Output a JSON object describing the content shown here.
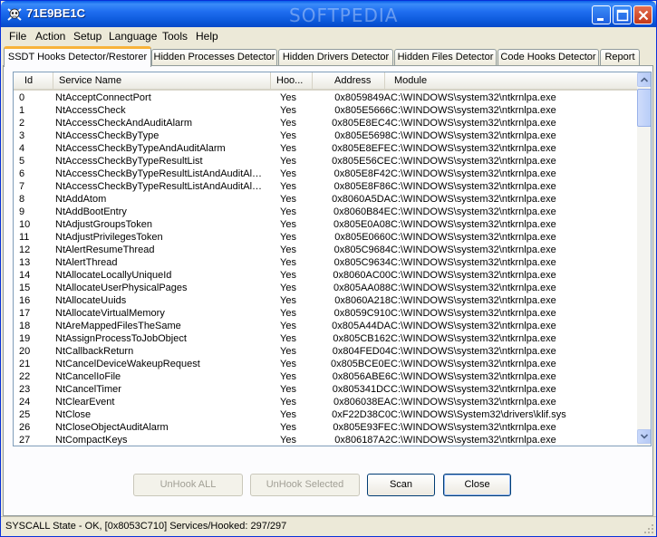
{
  "window": {
    "title": "71E9BE1C",
    "watermark": "SOFTPEDIA"
  },
  "menu": [
    "File",
    "Action",
    "Setup",
    "Language",
    "Tools",
    "Help"
  ],
  "tabs": [
    {
      "label": "SSDT Hooks Detector/Restorer",
      "active": true
    },
    {
      "label": "Hidden Processes Detector",
      "active": false
    },
    {
      "label": "Hidden Drivers Detector",
      "active": false
    },
    {
      "label": "Hidden Files Detector",
      "active": false
    },
    {
      "label": "Code Hooks Detector",
      "active": false
    },
    {
      "label": "Report",
      "active": false
    }
  ],
  "table": {
    "columns": [
      "Id",
      "Service Name",
      "Hoo...",
      "Address",
      "Module"
    ],
    "rows": [
      [
        "0",
        "NtAcceptConnectPort",
        "Yes",
        "0x8059849A",
        "C:\\WINDOWS\\system32\\ntkrnlpa.exe"
      ],
      [
        "1",
        "NtAccessCheck",
        "Yes",
        "0x805E5666",
        "C:\\WINDOWS\\system32\\ntkrnlpa.exe"
      ],
      [
        "2",
        "NtAccessCheckAndAuditAlarm",
        "Yes",
        "0x805E8EC4",
        "C:\\WINDOWS\\system32\\ntkrnlpa.exe"
      ],
      [
        "3",
        "NtAccessCheckByType",
        "Yes",
        "0x805E5698",
        "C:\\WINDOWS\\system32\\ntkrnlpa.exe"
      ],
      [
        "4",
        "NtAccessCheckByTypeAndAuditAlarm",
        "Yes",
        "0x805E8EFE",
        "C:\\WINDOWS\\system32\\ntkrnlpa.exe"
      ],
      [
        "5",
        "NtAccessCheckByTypeResultList",
        "Yes",
        "0x805E56CE",
        "C:\\WINDOWS\\system32\\ntkrnlpa.exe"
      ],
      [
        "6",
        "NtAccessCheckByTypeResultListAndAuditAlarm",
        "Yes",
        "0x805E8F42",
        "C:\\WINDOWS\\system32\\ntkrnlpa.exe"
      ],
      [
        "7",
        "NtAccessCheckByTypeResultListAndAuditAla...",
        "Yes",
        "0x805E8F86",
        "C:\\WINDOWS\\system32\\ntkrnlpa.exe"
      ],
      [
        "8",
        "NtAddAtom",
        "Yes",
        "0x8060A5DA",
        "C:\\WINDOWS\\system32\\ntkrnlpa.exe"
      ],
      [
        "9",
        "NtAddBootEntry",
        "Yes",
        "0x8060B84E",
        "C:\\WINDOWS\\system32\\ntkrnlpa.exe"
      ],
      [
        "10",
        "NtAdjustGroupsToken",
        "Yes",
        "0x805E0A08",
        "C:\\WINDOWS\\system32\\ntkrnlpa.exe"
      ],
      [
        "11",
        "NtAdjustPrivilegesToken",
        "Yes",
        "0x805E0660",
        "C:\\WINDOWS\\system32\\ntkrnlpa.exe"
      ],
      [
        "12",
        "NtAlertResumeThread",
        "Yes",
        "0x805C9684",
        "C:\\WINDOWS\\system32\\ntkrnlpa.exe"
      ],
      [
        "13",
        "NtAlertThread",
        "Yes",
        "0x805C9634",
        "C:\\WINDOWS\\system32\\ntkrnlpa.exe"
      ],
      [
        "14",
        "NtAllocateLocallyUniqueId",
        "Yes",
        "0x8060AC00",
        "C:\\WINDOWS\\system32\\ntkrnlpa.exe"
      ],
      [
        "15",
        "NtAllocateUserPhysicalPages",
        "Yes",
        "0x805AA088",
        "C:\\WINDOWS\\system32\\ntkrnlpa.exe"
      ],
      [
        "16",
        "NtAllocateUuids",
        "Yes",
        "0x8060A218",
        "C:\\WINDOWS\\system32\\ntkrnlpa.exe"
      ],
      [
        "17",
        "NtAllocateVirtualMemory",
        "Yes",
        "0x8059C910",
        "C:\\WINDOWS\\system32\\ntkrnlpa.exe"
      ],
      [
        "18",
        "NtAreMappedFilesTheSame",
        "Yes",
        "0x805A44DA",
        "C:\\WINDOWS\\system32\\ntkrnlpa.exe"
      ],
      [
        "19",
        "NtAssignProcessToJobObject",
        "Yes",
        "0x805CB162",
        "C:\\WINDOWS\\system32\\ntkrnlpa.exe"
      ],
      [
        "20",
        "NtCallbackReturn",
        "Yes",
        "0x804FED04",
        "C:\\WINDOWS\\system32\\ntkrnlpa.exe"
      ],
      [
        "21",
        "NtCancelDeviceWakeupRequest",
        "Yes",
        "0x805BCE0E",
        "C:\\WINDOWS\\system32\\ntkrnlpa.exe"
      ],
      [
        "22",
        "NtCancelIoFile",
        "Yes",
        "0x8056ABE6",
        "C:\\WINDOWS\\system32\\ntkrnlpa.exe"
      ],
      [
        "23",
        "NtCancelTimer",
        "Yes",
        "0x805341DC",
        "C:\\WINDOWS\\system32\\ntkrnlpa.exe"
      ],
      [
        "24",
        "NtClearEvent",
        "Yes",
        "0x806038EA",
        "C:\\WINDOWS\\system32\\ntkrnlpa.exe"
      ],
      [
        "25",
        "NtClose",
        "Yes",
        "0xF22D38C0",
        "C:\\WINDOWS\\System32\\drivers\\klif.sys"
      ],
      [
        "26",
        "NtCloseObjectAuditAlarm",
        "Yes",
        "0x805E93FE",
        "C:\\WINDOWS\\system32\\ntkrnlpa.exe"
      ],
      [
        "27",
        "NtCompactKeys",
        "Yes",
        "0x806187A2",
        "C:\\WINDOWS\\system32\\ntkrnlpa.exe"
      ]
    ]
  },
  "buttons": {
    "unhook_all": "UnHook ALL",
    "unhook_selected": "UnHook Selected",
    "scan": "Scan",
    "close": "Close"
  },
  "status": "SYSCALL State - OK,  [0x8053C710]  Services/Hooked: 297/297",
  "icons": {
    "app": "skull-icon",
    "minimize": "minimize-icon",
    "maximize": "maximize-icon",
    "close": "close-icon"
  }
}
